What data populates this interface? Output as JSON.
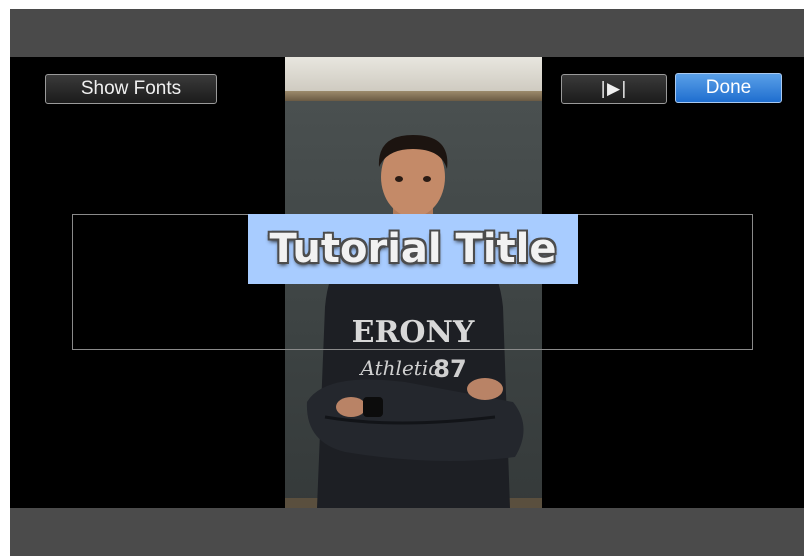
{
  "toolbar": {
    "show_fonts_label": "Show Fonts",
    "play_icon_glyph": "|▶|",
    "done_label": "Done"
  },
  "title_overlay": {
    "text": "Tutorial Title",
    "highlight_color": "#a8ccff"
  },
  "colors": {
    "frame": "#4a4a4a",
    "viewer_background": "#000000",
    "done_button": "#2a7ae0"
  },
  "icons": {
    "play": "play-selection-icon"
  }
}
